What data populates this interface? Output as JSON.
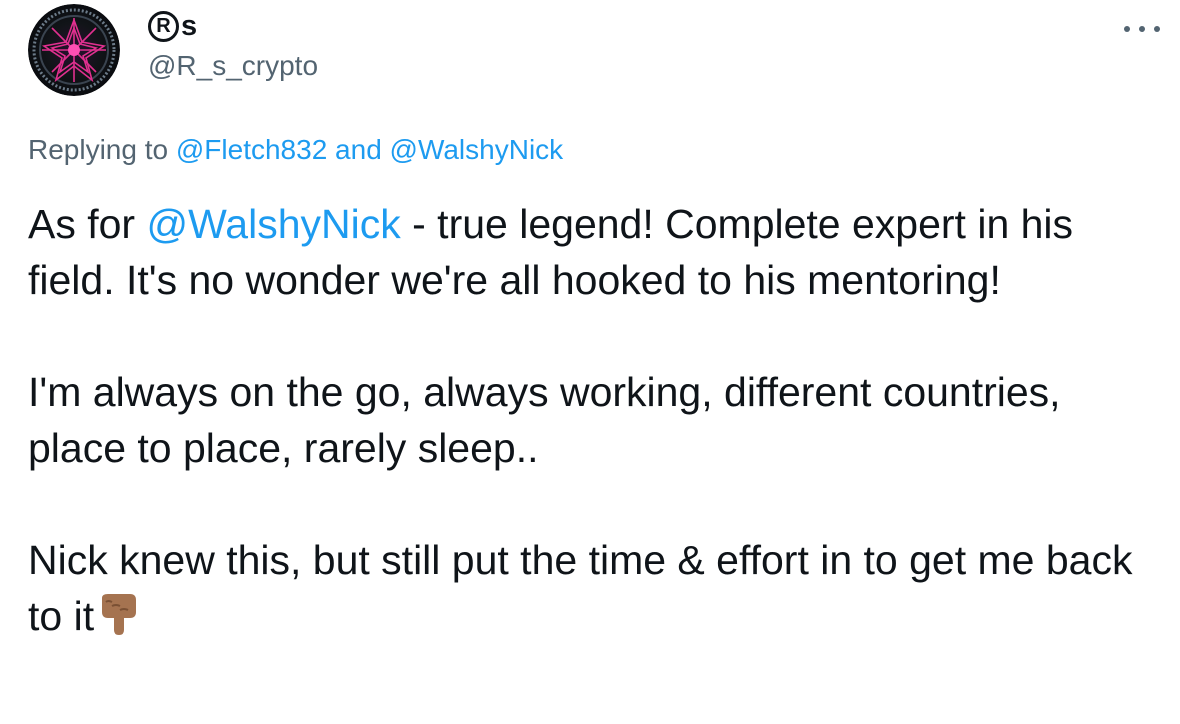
{
  "tweet": {
    "author": {
      "avatar_icon": "purple-star-avatar-icon",
      "name_symbol": "R",
      "name_suffix": "s",
      "handle": "@R_s_crypto"
    },
    "more_icon": "more-options-icon",
    "replying": {
      "prefix": "Replying to",
      "first": "@Fletch832",
      "joiner": "and",
      "second": "@WalshyNick"
    },
    "body": {
      "p1_before": "As for",
      "p1_mention": "@WalshyNick",
      "p1_after": "- true legend! Complete expert in his field. It's no wonder we're all hooked to his mentoring!",
      "p2": "I'm always on the go, always working, different countries, place to place, rarely sleep..",
      "p3": "Nick knew this, but still put the time & effort in to get me back to it",
      "p3_emoji": "pointing-down-hand-icon"
    },
    "colors": {
      "link": "#1d9bf0",
      "secondary_text": "#536471",
      "primary_text": "#0f1419"
    }
  }
}
